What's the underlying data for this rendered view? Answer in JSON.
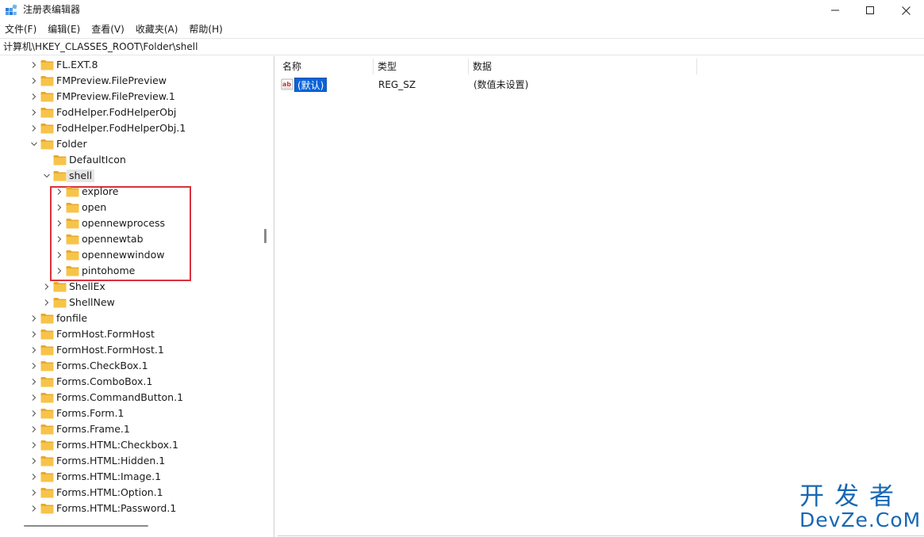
{
  "window": {
    "title": "注册表编辑器",
    "minimize_icon": "minimize-icon",
    "maximize_icon": "maximize-icon",
    "close_icon": "close-icon"
  },
  "menu": [
    "文件(F)",
    "编辑(E)",
    "查看(V)",
    "收藏夹(A)",
    "帮助(H)"
  ],
  "address": "计算机\\HKEY_CLASSES_ROOT\\Folder\\shell",
  "tree": [
    {
      "label": "FL.EXT.8",
      "depth": 0,
      "expander": "collapsed"
    },
    {
      "label": "FMPreview.FilePreview",
      "depth": 0,
      "expander": "collapsed"
    },
    {
      "label": "FMPreview.FilePreview.1",
      "depth": 0,
      "expander": "collapsed"
    },
    {
      "label": "FodHelper.FodHelperObj",
      "depth": 0,
      "expander": "collapsed"
    },
    {
      "label": "FodHelper.FodHelperObj.1",
      "depth": 0,
      "expander": "collapsed"
    },
    {
      "label": "Folder",
      "depth": 0,
      "expander": "expanded"
    },
    {
      "label": "DefaultIcon",
      "depth": 1,
      "expander": "none"
    },
    {
      "label": "shell",
      "depth": 1,
      "expander": "expanded",
      "selected": true
    },
    {
      "label": "explore",
      "depth": 2,
      "expander": "collapsed"
    },
    {
      "label": "open",
      "depth": 2,
      "expander": "collapsed"
    },
    {
      "label": "opennewprocess",
      "depth": 2,
      "expander": "collapsed"
    },
    {
      "label": "opennewtab",
      "depth": 2,
      "expander": "collapsed"
    },
    {
      "label": "opennewwindow",
      "depth": 2,
      "expander": "collapsed"
    },
    {
      "label": "pintohome",
      "depth": 2,
      "expander": "collapsed"
    },
    {
      "label": "ShellEx",
      "depth": 1,
      "expander": "collapsed"
    },
    {
      "label": "ShellNew",
      "depth": 1,
      "expander": "collapsed"
    },
    {
      "label": "fonfile",
      "depth": 0,
      "expander": "collapsed"
    },
    {
      "label": "FormHost.FormHost",
      "depth": 0,
      "expander": "collapsed"
    },
    {
      "label": "FormHost.FormHost.1",
      "depth": 0,
      "expander": "collapsed"
    },
    {
      "label": "Forms.CheckBox.1",
      "depth": 0,
      "expander": "collapsed"
    },
    {
      "label": "Forms.ComboBox.1",
      "depth": 0,
      "expander": "collapsed"
    },
    {
      "label": "Forms.CommandButton.1",
      "depth": 0,
      "expander": "collapsed"
    },
    {
      "label": "Forms.Form.1",
      "depth": 0,
      "expander": "collapsed"
    },
    {
      "label": "Forms.Frame.1",
      "depth": 0,
      "expander": "collapsed"
    },
    {
      "label": "Forms.HTML:Checkbox.1",
      "depth": 0,
      "expander": "collapsed"
    },
    {
      "label": "Forms.HTML:Hidden.1",
      "depth": 0,
      "expander": "collapsed"
    },
    {
      "label": "Forms.HTML:Image.1",
      "depth": 0,
      "expander": "collapsed"
    },
    {
      "label": "Forms.HTML:Option.1",
      "depth": 0,
      "expander": "collapsed"
    },
    {
      "label": "Forms.HTML:Password.1",
      "depth": 0,
      "expander": "collapsed"
    }
  ],
  "values": {
    "columns": [
      "名称",
      "类型",
      "数据"
    ],
    "rows": [
      {
        "name": "(默认)",
        "type": "REG_SZ",
        "data": "(数值未设置)",
        "icon": "string-value-icon"
      }
    ]
  },
  "watermark": {
    "line1": "开发者",
    "line2": "DevZe.CoM"
  },
  "colors": {
    "folder": "#f6c44a",
    "selection": "#0a64d8",
    "highlight_box": "#d9313c",
    "watermark": "#1767b4"
  }
}
